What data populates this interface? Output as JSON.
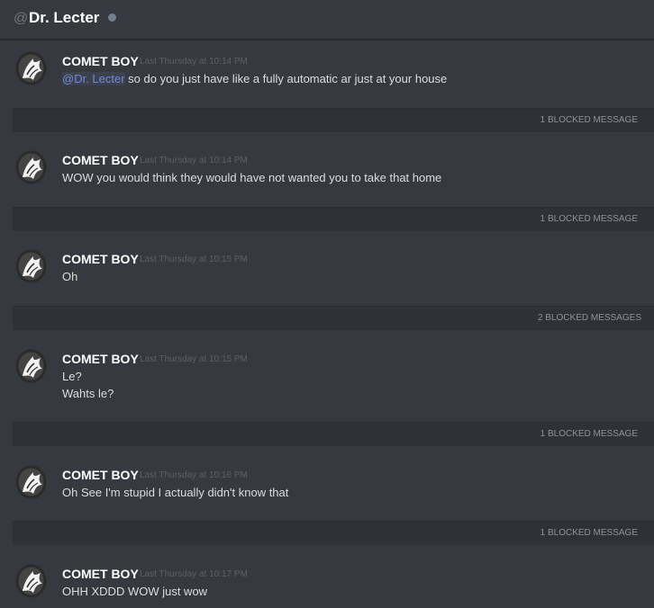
{
  "header": {
    "at_symbol": "@",
    "dm_name": "Dr. Lecter"
  },
  "colors": {
    "background": "#36393f",
    "blocked_bar": "#2f3136",
    "mention": "#7289da",
    "timestamp": "#5c6067",
    "status_offline": "#747f8d"
  },
  "messages": [
    {
      "author": "COMET BOY",
      "timestamp": "Last Thursday at 10:14 PM",
      "mention": "@Dr. Lecter",
      "lines": [
        " so do you just have like a fully automatic ar just at your house"
      ]
    },
    {
      "author": "COMET BOY",
      "timestamp": "Last Thursday at 10:14 PM",
      "lines": [
        "WOW you would think they would have not wanted you to take that home"
      ]
    },
    {
      "author": "COMET BOY",
      "timestamp": "Last Thursday at 10:15 PM",
      "lines": [
        "Oh"
      ]
    },
    {
      "author": "COMET BOY",
      "timestamp": "Last Thursday at 10:15 PM",
      "lines": [
        "Le?",
        "Wahts le?"
      ]
    },
    {
      "author": "COMET BOY",
      "timestamp": "Last Thursday at 10:16 PM",
      "lines": [
        "Oh See I'm stupid I actually didn't know that"
      ]
    },
    {
      "author": "COMET BOY",
      "timestamp": "Last Thursday at 10:17 PM",
      "lines": [
        "OHH XDDD WOW just wow"
      ]
    }
  ],
  "blocked_bars": [
    {
      "label": "1 BLOCKED MESSAGE"
    },
    {
      "label": "1 BLOCKED MESSAGE"
    },
    {
      "label": "2 BLOCKED MESSAGES"
    },
    {
      "label": "1 BLOCKED MESSAGE"
    },
    {
      "label": "1 BLOCKED MESSAGE"
    }
  ]
}
